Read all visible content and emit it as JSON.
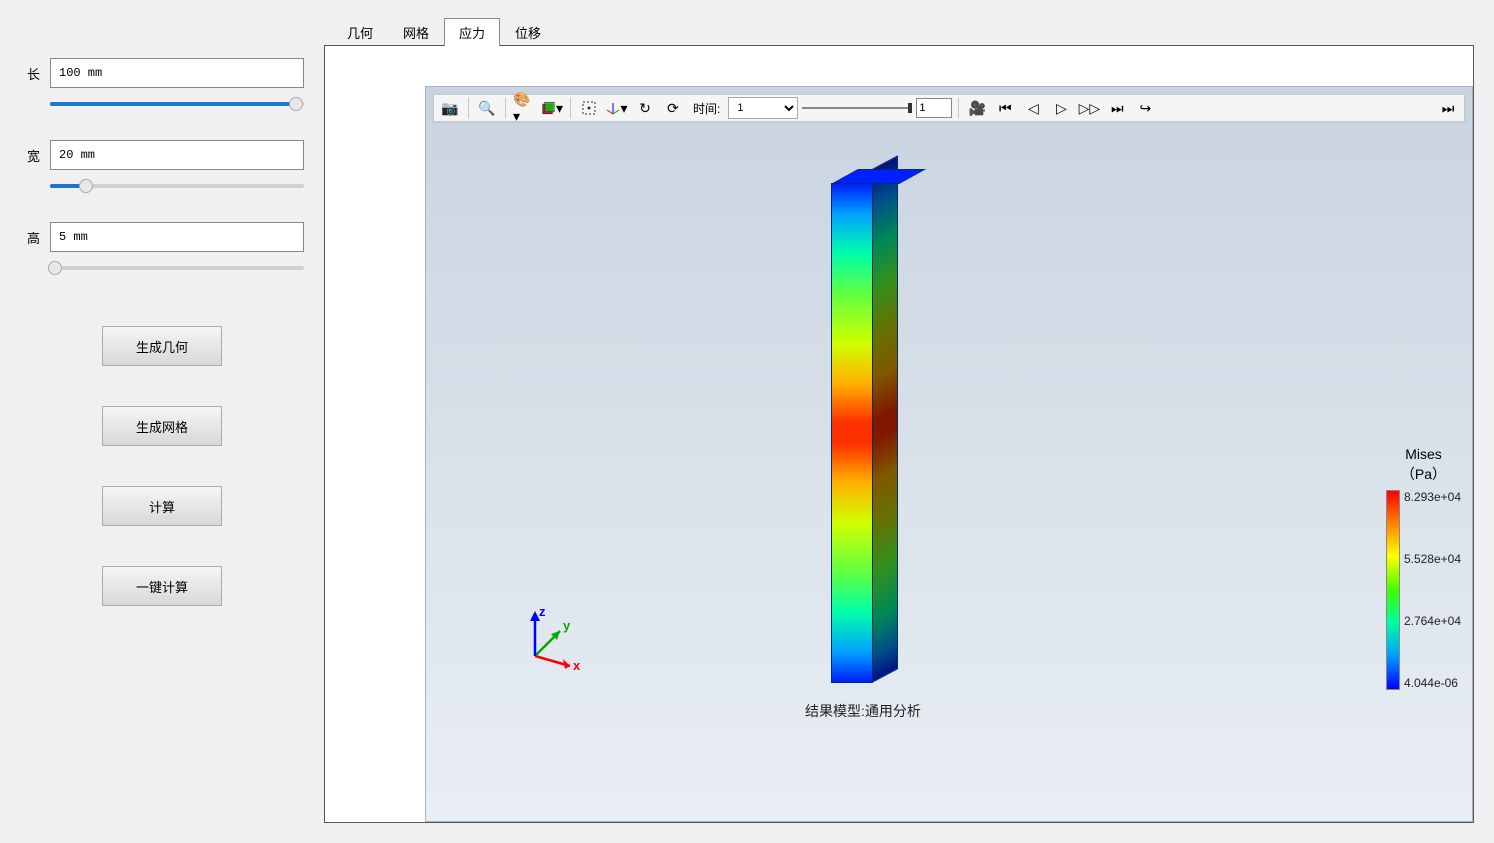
{
  "sidebar": {
    "params": [
      {
        "label": "长",
        "value": "100 mm",
        "slider_pct": 97
      },
      {
        "label": "宽",
        "value": "20 mm",
        "slider_pct": 14
      },
      {
        "label": "高",
        "value": "5 mm",
        "slider_pct": 2
      }
    ],
    "buttons": {
      "generate_geometry": "生成几何",
      "generate_mesh": "生成网格",
      "compute": "计算",
      "one_click": "一键计算"
    }
  },
  "tabs": {
    "items": [
      "几何",
      "网格",
      "应力",
      "位移"
    ],
    "active_index": 2
  },
  "toolbar": {
    "time_label": "时间:",
    "time_value": "1",
    "step_value": "1"
  },
  "viewport": {
    "result_label": "结果模型:通用分析",
    "axes": {
      "x": "x",
      "y": "y",
      "z": "z"
    }
  },
  "legend": {
    "title": "Mises",
    "unit": "（Pa）",
    "ticks": [
      "8.293e+04",
      "5.528e+04",
      "2.764e+04",
      "4.044e-06"
    ]
  }
}
